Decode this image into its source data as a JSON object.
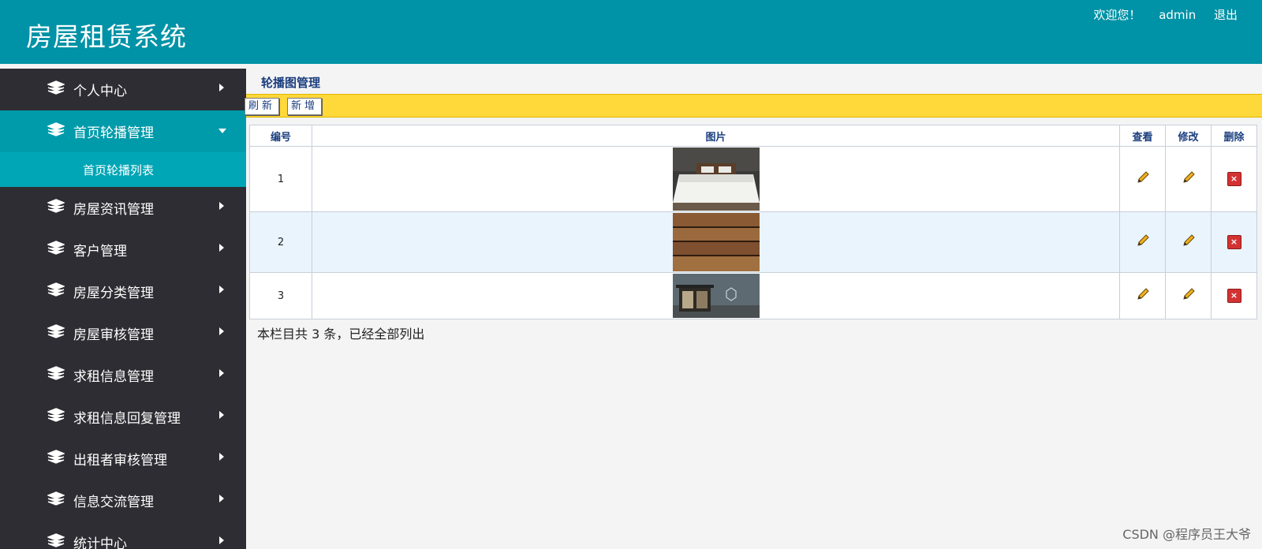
{
  "header": {
    "title": "房屋租赁系统",
    "welcome": "欢迎您！",
    "user": "admin",
    "logout": "退出"
  },
  "sidebar": {
    "items": [
      {
        "label": "个人中心",
        "active": false
      },
      {
        "label": "首页轮播管理",
        "active": true,
        "children": [
          {
            "label": "首页轮播列表"
          }
        ]
      },
      {
        "label": "房屋资讯管理",
        "active": false
      },
      {
        "label": "客户管理",
        "active": false
      },
      {
        "label": "房屋分类管理",
        "active": false
      },
      {
        "label": "房屋审核管理",
        "active": false
      },
      {
        "label": "求租信息管理",
        "active": false
      },
      {
        "label": "求租信息回复管理",
        "active": false
      },
      {
        "label": "出租者审核管理",
        "active": false
      },
      {
        "label": "信息交流管理",
        "active": false
      },
      {
        "label": "统计中心",
        "active": false
      }
    ]
  },
  "main": {
    "page_title": "轮播图管理",
    "toolbar": {
      "refresh": "刷新",
      "add": "新增"
    },
    "table": {
      "columns": [
        "编号",
        "图片",
        "查看",
        "修改",
        "删除"
      ],
      "rows": [
        {
          "id": "1",
          "image": "bedroom"
        },
        {
          "id": "2",
          "image": "bookshelf"
        },
        {
          "id": "3",
          "image": "house-exterior"
        }
      ]
    },
    "footer_note": "本栏目共 3 条，已经全部列出"
  },
  "watermark": "CSDN @程序员王大爷",
  "colors": {
    "header": "#0092a6",
    "sidebar": "#2d2d33",
    "active_nav": "#009baa",
    "sub_nav": "#00a6b6",
    "toolbar": "#ffd83a",
    "row_alt": "#e9f4fd"
  }
}
